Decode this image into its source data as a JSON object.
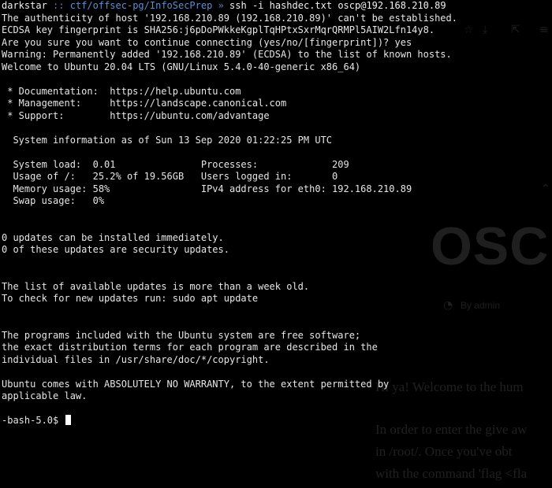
{
  "prompt": {
    "user": "darkstar",
    "separator": "::",
    "path": "ctf/offsec-pg/InfoSecPrep",
    "arrow": "»",
    "command": "ssh -i hashdec.txt oscp@192.168.210.89"
  },
  "output_top": [
    "The authenticity of host '192.168.210.89 (192.168.210.89)' can't be established.",
    "ECDSA key fingerprint is SHA256:j6pDoPWkkeKgplTqHPtxSxrMqrQRMPl5AIW2Lfn14y8.",
    "Are you sure you want to continue connecting (yes/no/[fingerprint])? yes",
    "Warning: Permanently added '192.168.210.89' (ECDSA) to the list of known hosts.",
    "Welcome to Ubuntu 20.04 LTS (GNU/Linux 5.4.0-40-generic x86_64)",
    "",
    " * Documentation:  https://help.ubuntu.com",
    " * Management:     https://landscape.canonical.com",
    " * Support:        https://ubuntu.com/advantage",
    "",
    "  System information as of Sun 13 Sep 2020 01:22:25 PM UTC",
    "",
    "  System load:  0.01               Processes:             209",
    "  Usage of /:   25.2% of 19.56GB   Users logged in:       0",
    "  Memory usage: 58%                IPv4 address for eth0: 192.168.210.89",
    "  Swap usage:   0%",
    "",
    "",
    "0 updates can be installed immediately.",
    "0 of these updates are security updates.",
    "",
    "",
    "The list of available updates is more than a week old.",
    "To check for new updates run: sudo apt update",
    "",
    "",
    "The programs included with the Ubuntu system are free software;",
    "the exact distribution terms for each program are described in the",
    "individual files in /usr/share/doc/*/copyright.",
    "",
    "Ubuntu comes with ABSOLUTELY NO WARRANTY, to the extent permitted by",
    "applicable law.",
    "",
    "-bash-5.0$"
  ],
  "background_page": {
    "heading": "OSCP",
    "author": "By admin",
    "body_line_1": "Hi ya! Welcome to the hum",
    "body_line_2": "In order to enter the give aw",
    "body_line_3": "in /root/. Once you've obt",
    "body_line_4": "with the command 'flag <fla"
  },
  "colors": {
    "terminal_bg": "#000000",
    "terminal_fg": "#e6e6e6",
    "path": "#5f8fc8",
    "separator": "#5f7fa6",
    "cursor": "#ffffff"
  }
}
